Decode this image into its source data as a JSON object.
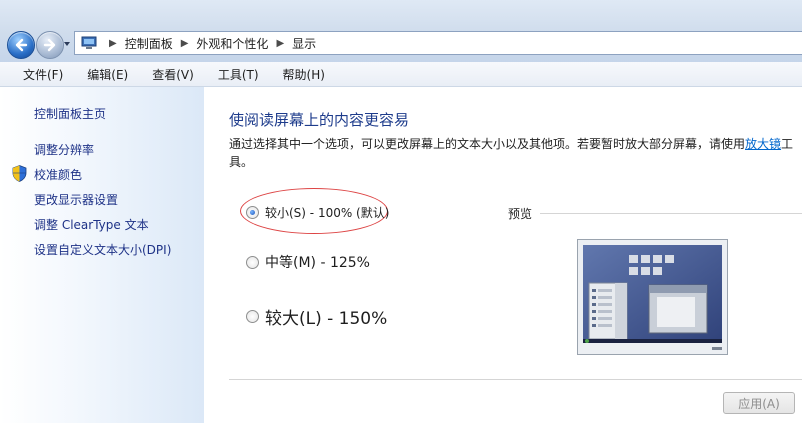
{
  "address_bar": {
    "crumbs": [
      "控制面板",
      "外观和个性化",
      "显示"
    ]
  },
  "menu": [
    "文件(F)",
    "编辑(E)",
    "查看(V)",
    "工具(T)",
    "帮助(H)"
  ],
  "sidebar": {
    "home": "控制面板主页",
    "items": [
      "调整分辨率",
      "校准颜色",
      "更改显示器设置",
      "调整 ClearType 文本",
      "设置自定义文本大小(DPI)"
    ]
  },
  "main": {
    "heading": "使阅读屏幕上的内容更容易",
    "description": "通过选择其中一个选项，可以更改屏幕上的文本大小以及其他项。若要暂时放大部分屏幕，请使用",
    "magnifier_link": "放大镜",
    "description_tail": "工具。",
    "options": [
      {
        "label": "较小(S) - 100% (默认)",
        "checked": true
      },
      {
        "label": "中等(M) - 125%",
        "checked": false
      },
      {
        "label": "较大(L) - 150%",
        "checked": false
      }
    ],
    "preview_label": "预览",
    "apply_button": "应用(A)"
  },
  "colors": {
    "link": "#1e3287",
    "heading": "#1e3c8c",
    "highlight_circle": "#dd4444"
  }
}
